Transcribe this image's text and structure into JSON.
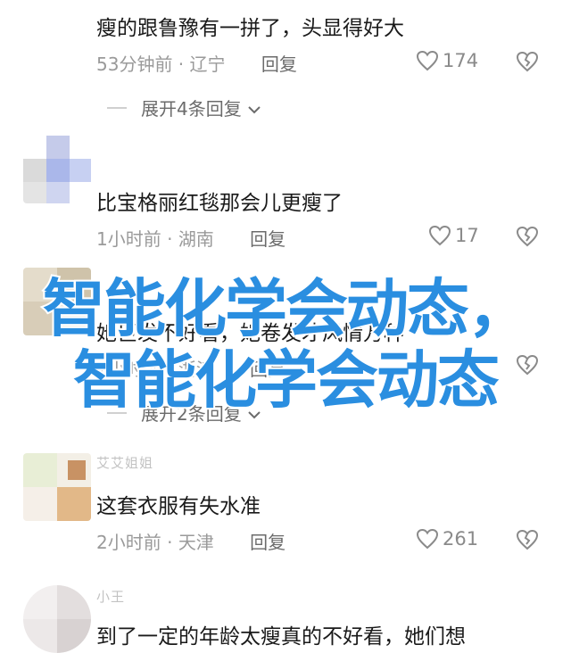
{
  "comments": [
    {
      "text": "瘦的跟鲁豫有一拼了，头显得好大",
      "time": "53分钟前",
      "location": "辽宁",
      "reply": "回复",
      "likes": "174"
    },
    {
      "text": "比宝格丽红毯那会儿更瘦了",
      "time": "1小时前",
      "location": "湖南",
      "reply": "回复",
      "likes": "17"
    },
    {
      "text": "她巨发不好看，她卷发才风情万种",
      "time": "2小时前",
      "location": "浙江",
      "reply": "回复",
      "likes": ""
    },
    {
      "username": "艾艾姐姐",
      "text": "这套衣服有失水准",
      "time": "2小时前",
      "location": "天津",
      "reply": "回复",
      "likes": "261"
    },
    {
      "username": "小王",
      "text": "到了一定的年龄太瘦真的不好看，她们想"
    }
  ],
  "expand_1": "展开4条回复",
  "expand_2": "展开2条回复",
  "separator": " · ",
  "overlay": {
    "line1": "智能化学会动态，",
    "line2": "智能化学会动态"
  },
  "colors": {
    "overlay_text": "#2a8ee0",
    "meta_text": "#9a9a9a"
  }
}
